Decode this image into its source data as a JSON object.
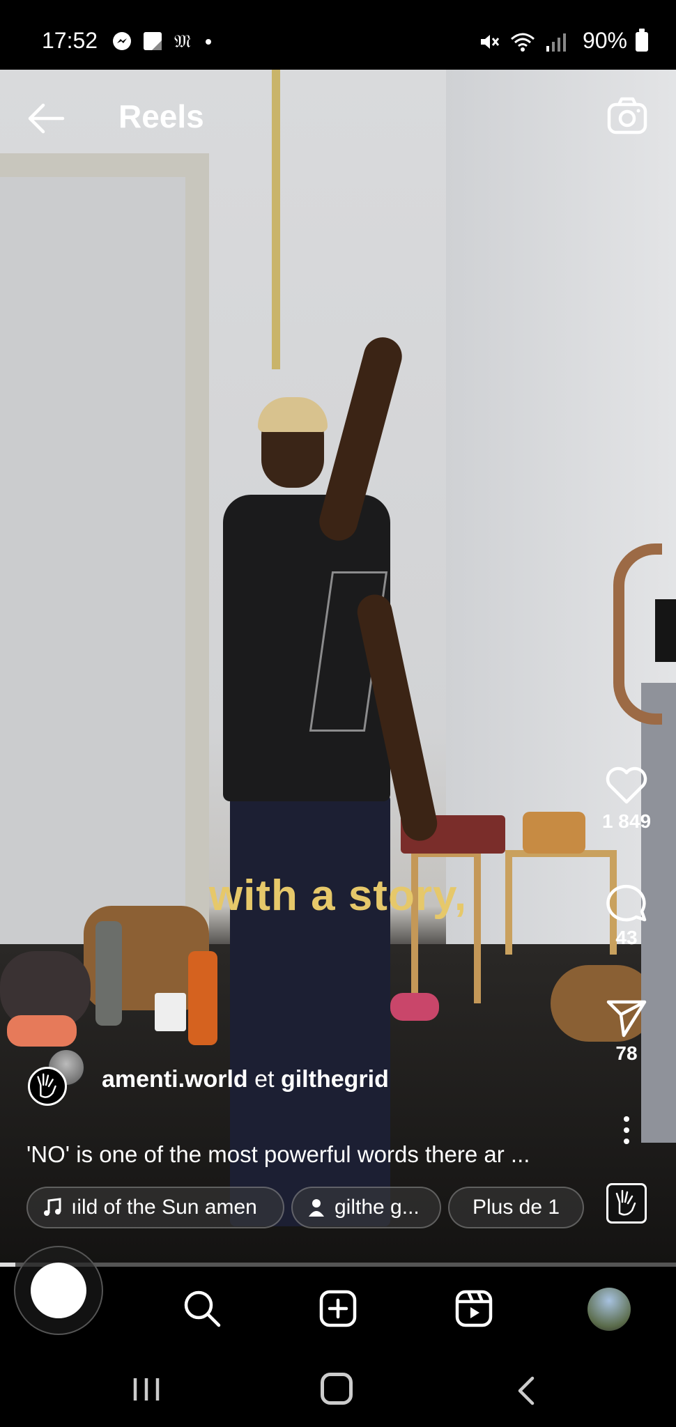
{
  "status_bar": {
    "time": "17:52",
    "battery": "90%",
    "left_icons": [
      "messenger-icon",
      "notes-icon",
      "m-app-icon",
      "dot-icon"
    ],
    "right_icons": [
      "mute-icon",
      "wifi-icon",
      "signal-icon",
      "battery-icon"
    ]
  },
  "header": {
    "title": "Reels"
  },
  "video": {
    "caption_overlay": "with a story,"
  },
  "actions": {
    "likes": "1 849",
    "comments": "43",
    "shares": "78"
  },
  "author": {
    "primary": "amenti.world",
    "connector": "et",
    "secondary": "gilthegrid"
  },
  "description": "'NO' is one of the most powerful words there ar ...",
  "chips": {
    "music": "ıild of the Sun   amen",
    "user": "gilthe g...",
    "more": "Plus de 1"
  },
  "progress": 0.023,
  "bottom_nav": [
    "home-icon",
    "search-icon",
    "create-icon",
    "reels-icon",
    "profile-avatar"
  ]
}
